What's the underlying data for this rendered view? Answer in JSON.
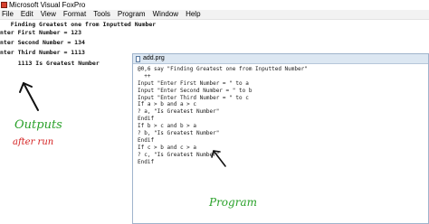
{
  "window": {
    "title": "Microsoft Visual FoxPro"
  },
  "menu": [
    "File",
    "Edit",
    "View",
    "Format",
    "Tools",
    "Program",
    "Window",
    "Help"
  ],
  "output": {
    "lines": [
      "   Finding Greatest one from Inputted Number",
      "nter First Number = 123",
      "nter Second Number = 134",
      "nter Third Number = 1113",
      "   1113 Is Greatest Number"
    ]
  },
  "annotations": {
    "outputs_label": "Outputs",
    "after_run_label": "after run",
    "program_label": "Program"
  },
  "colors": {
    "outputs_label": "#2aa12a",
    "after_run_label": "#d42020",
    "program_label": "#2aa12a"
  },
  "editor": {
    "title": "add.prg",
    "code": [
      "@0,6 say \"Finding Greatest one from Inputted Number\"",
      "  ++",
      "Input \"Enter First Number = \" to a",
      "Input \"Enter Second Number = \" to b",
      "Input \"Enter Third Number = \" to c",
      "If a > b and a > c",
      "? a, \"Is Greatest Number\"",
      "Endif",
      "If b > c and b > a",
      "? b, \"Is Greatest Number\"",
      "Endif",
      "If c > b and c > a",
      "? c, \"Is Greatest Number\"",
      "Endif"
    ]
  }
}
